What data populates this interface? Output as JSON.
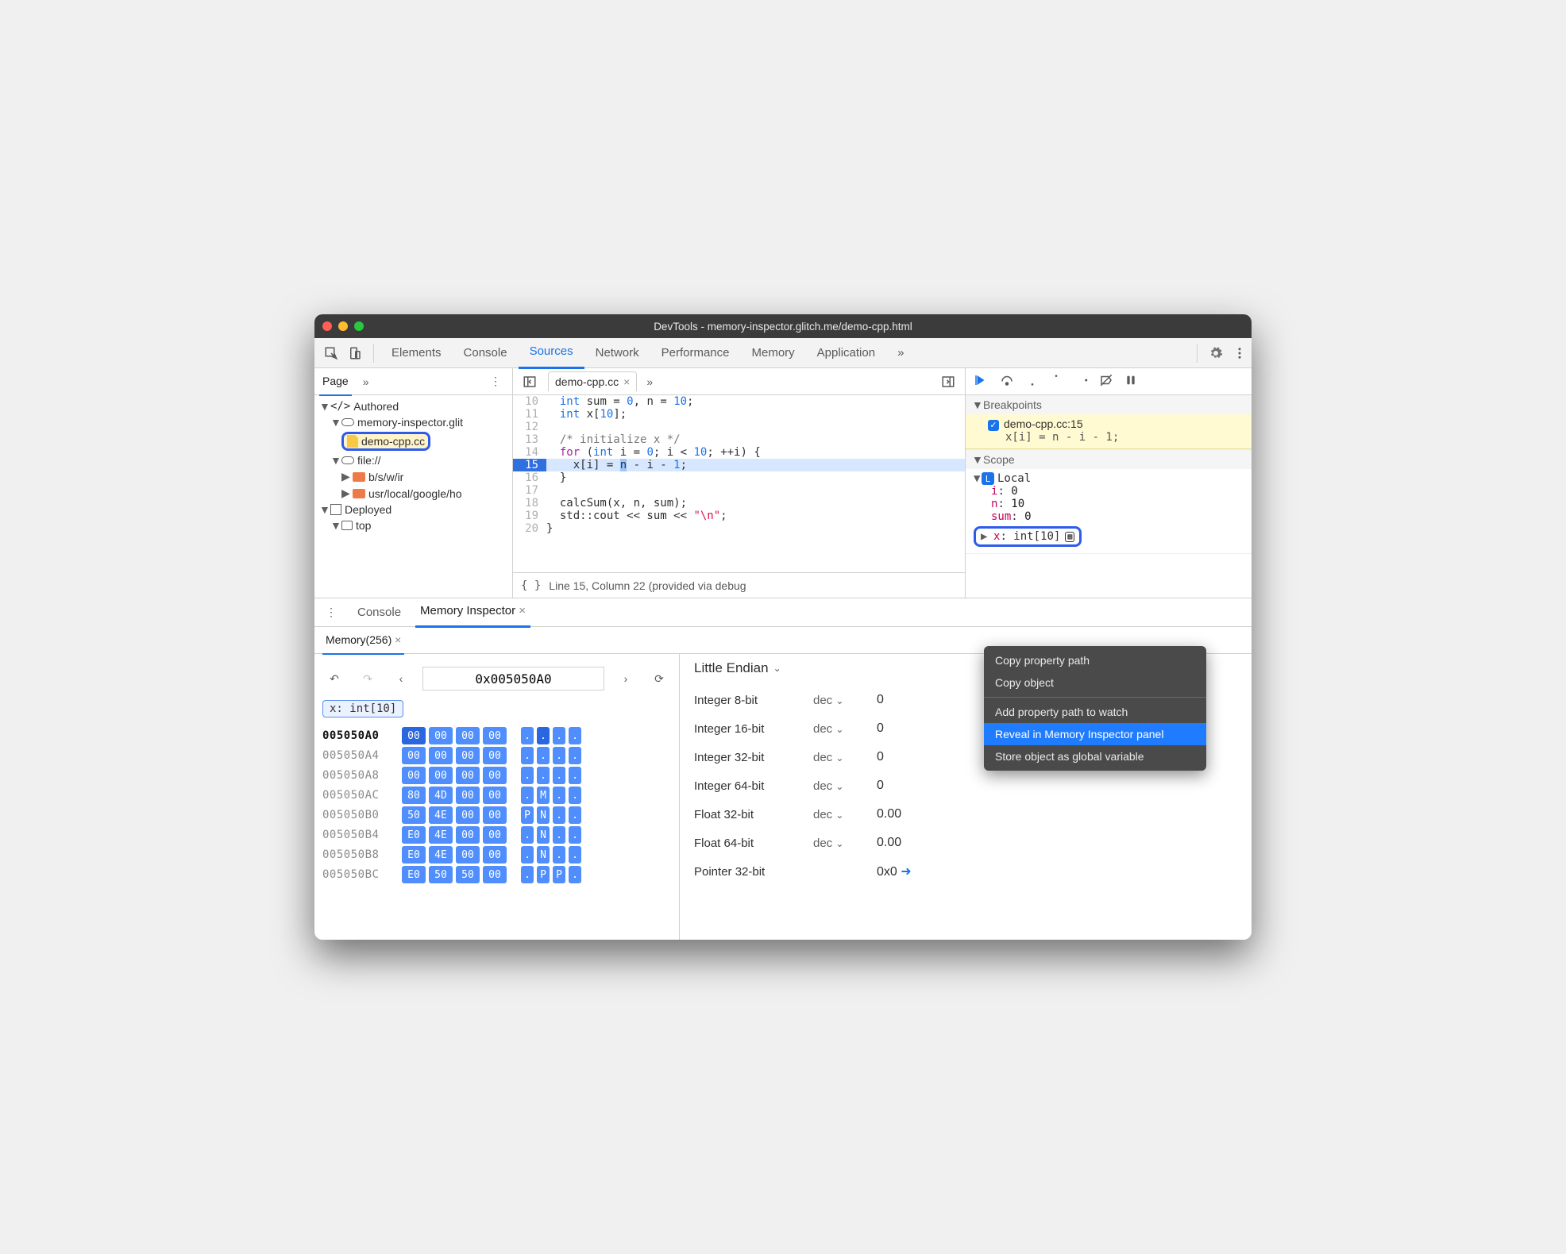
{
  "window": {
    "title": "DevTools - memory-inspector.glitch.me/demo-cpp.html"
  },
  "tabs": {
    "items": [
      "Elements",
      "Console",
      "Sources",
      "Network",
      "Performance",
      "Memory",
      "Application"
    ],
    "active": "Sources",
    "overflow": "»"
  },
  "navigator": {
    "subtab": "Page",
    "overflow": "»",
    "authored_label": "Authored",
    "site_label": "memory-inspector.glit",
    "selected_file": "demo-cpp.cc",
    "file_scheme_label": "file://",
    "dir_a": "b/s/w/ir",
    "dir_b": "usr/local/google/ho",
    "deployed_label": "Deployed",
    "top_label": "top"
  },
  "editor": {
    "file_tab": "demo-cpp.cc",
    "overflow": "»",
    "status": "Line 15, Column 22  (provided via debug",
    "lines": [
      {
        "n": 10,
        "html": "  <span class='ty'>int</span> sum = <span class='num'>0</span>, n = <span class='num'>10</span>;"
      },
      {
        "n": 11,
        "html": "  <span class='ty'>int</span> x[<span class='num'>10</span>];"
      },
      {
        "n": 12,
        "html": ""
      },
      {
        "n": 13,
        "html": "  <span class='cm'>/* initialize x */</span>"
      },
      {
        "n": 14,
        "html": "  <span class='kw'>for</span> (<span class='ty'>int</span> i = <span class='num'>0</span>; i &lt; <span class='num'>10</span>; ++i) {"
      },
      {
        "n": 15,
        "html": "    x[i] = <span class='sel'>n</span> - i - <span class='num'>1</span>;",
        "hl": true
      },
      {
        "n": 16,
        "html": "  }"
      },
      {
        "n": 17,
        "html": ""
      },
      {
        "n": 18,
        "html": "  calcSum(x, n, sum);"
      },
      {
        "n": 19,
        "html": "  std::cout &lt;&lt; sum &lt;&lt; <span class='str'>\"\\n\"</span>;"
      },
      {
        "n": 20,
        "html": "}"
      }
    ]
  },
  "debugger": {
    "breakpoints_label": "Breakpoints",
    "bp_title": "demo-cpp.cc:15",
    "bp_code": "x[i] = n - i - 1;",
    "scope_label": "Scope",
    "local_label": "Local",
    "vars": [
      {
        "name": "i",
        "value": "0"
      },
      {
        "name": "n",
        "value": "10"
      },
      {
        "name": "sum",
        "value": "0"
      }
    ],
    "x_label": "x",
    "x_type": "int[10]"
  },
  "context_menu": {
    "items": [
      "Copy property path",
      "Copy object",
      "Add property path to watch",
      "Reveal in Memory Inspector panel",
      "Store object as global variable"
    ],
    "selected_index": 3
  },
  "drawer": {
    "console_label": "Console",
    "mi_label": "Memory Inspector",
    "memory_tab": "Memory(256)"
  },
  "memory": {
    "address": "0x005050A0",
    "chip": "x: int[10]",
    "rows": [
      {
        "addr": "005050A0",
        "hex": [
          "00",
          "00",
          "00",
          "00"
        ],
        "asc": [
          ".",
          ".",
          ".",
          "."
        ],
        "first": true,
        "hi_hex": 0,
        "hi_asc": 1
      },
      {
        "addr": "005050A4",
        "hex": [
          "00",
          "00",
          "00",
          "00"
        ],
        "asc": [
          ".",
          ".",
          ".",
          "."
        ]
      },
      {
        "addr": "005050A8",
        "hex": [
          "00",
          "00",
          "00",
          "00"
        ],
        "asc": [
          ".",
          ".",
          ".",
          "."
        ]
      },
      {
        "addr": "005050AC",
        "hex": [
          "80",
          "4D",
          "00",
          "00"
        ],
        "asc": [
          ".",
          "M",
          ".",
          "."
        ]
      },
      {
        "addr": "005050B0",
        "hex": [
          "50",
          "4E",
          "00",
          "00"
        ],
        "asc": [
          "P",
          "N",
          ".",
          "."
        ]
      },
      {
        "addr": "005050B4",
        "hex": [
          "E0",
          "4E",
          "00",
          "00"
        ],
        "asc": [
          ".",
          "N",
          ".",
          "."
        ]
      },
      {
        "addr": "005050B8",
        "hex": [
          "E0",
          "4E",
          "00",
          "00"
        ],
        "asc": [
          ".",
          "N",
          ".",
          "."
        ]
      },
      {
        "addr": "005050BC",
        "hex": [
          "E0",
          "50",
          "50",
          "00"
        ],
        "asc": [
          ".",
          "P",
          "P",
          "."
        ]
      }
    ]
  },
  "inspector": {
    "endian": "Little Endian",
    "types": [
      {
        "name": "Integer 8-bit",
        "fmt": "dec",
        "val": "0"
      },
      {
        "name": "Integer 16-bit",
        "fmt": "dec",
        "val": "0"
      },
      {
        "name": "Integer 32-bit",
        "fmt": "dec",
        "val": "0"
      },
      {
        "name": "Integer 64-bit",
        "fmt": "dec",
        "val": "0"
      },
      {
        "name": "Float 32-bit",
        "fmt": "dec",
        "val": "0.00"
      },
      {
        "name": "Float 64-bit",
        "fmt": "dec",
        "val": "0.00"
      },
      {
        "name": "Pointer 32-bit",
        "fmt": "",
        "val": "0x0",
        "link": true
      }
    ]
  }
}
